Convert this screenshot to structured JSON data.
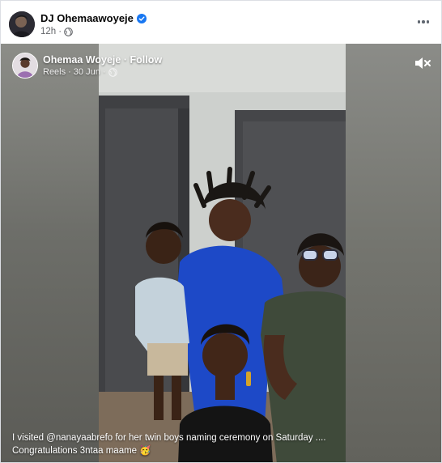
{
  "post": {
    "author": "DJ Ohemaawoyeje",
    "time": "12h",
    "more_icon": "ellipsis-icon"
  },
  "reel": {
    "author": "Ohemaa Woyeje",
    "follow_separator": "·",
    "follow_label": "Follow",
    "type": "Reels",
    "date": "30 Jun",
    "mute_icon": "speaker-muted-icon",
    "caption_line1": "I visited @nanayaabrefo for her twin boys naming ceremony on Saturday ....",
    "caption_line2": "Congratulations 3ntaa maame 🥳"
  },
  "colors": {
    "verified": "#1877f2",
    "meta_text": "#65676b",
    "video_bg": "#7e7e7a"
  }
}
